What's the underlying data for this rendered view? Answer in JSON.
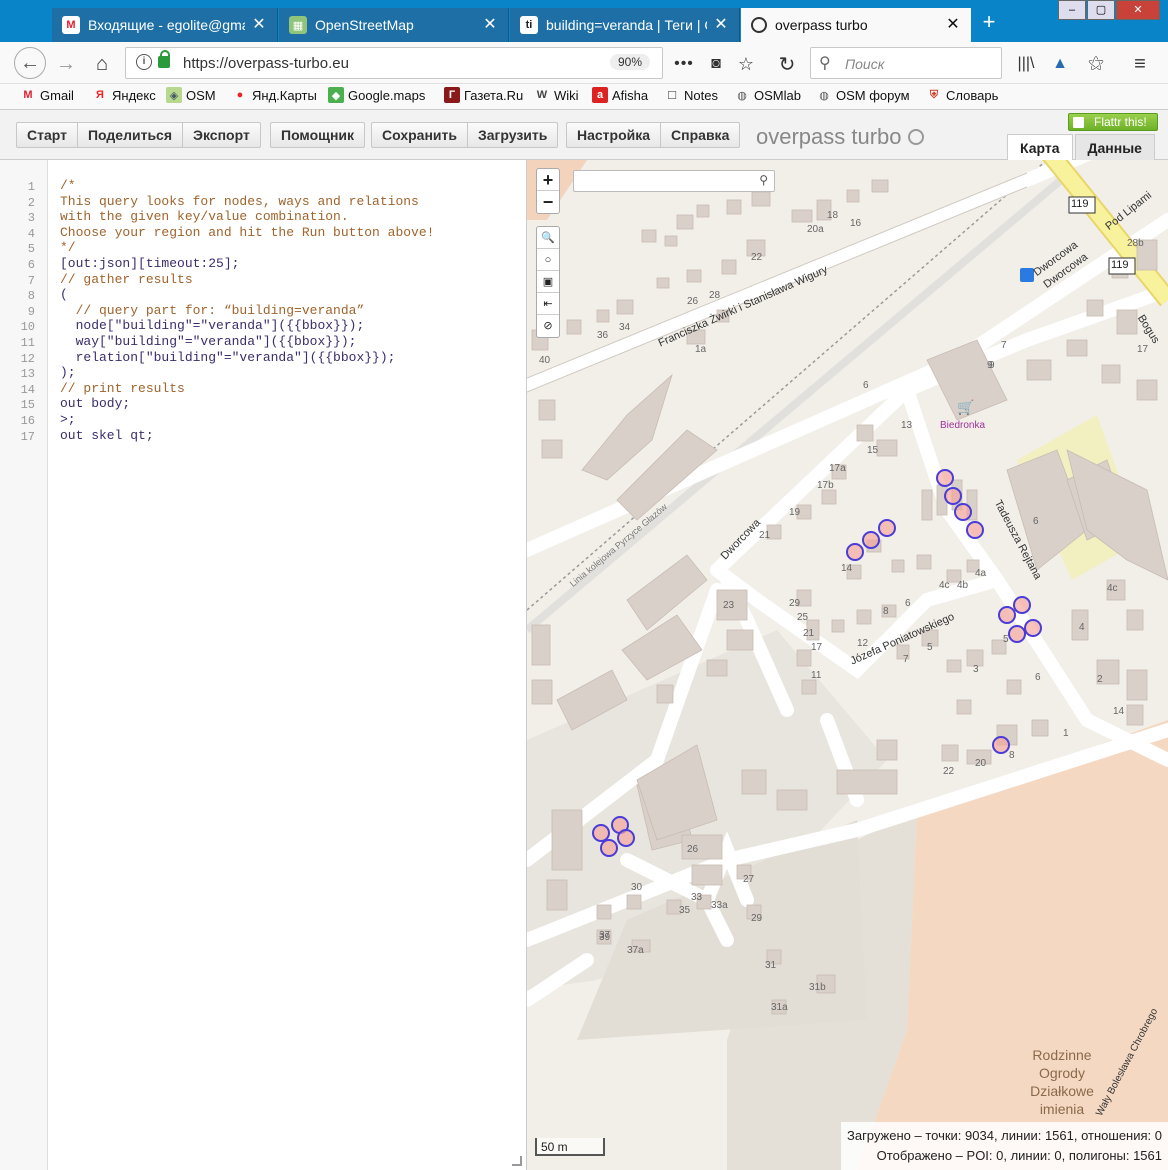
{
  "browser": {
    "tabs": [
      {
        "title": "Входящие - egolite@gmail.c",
        "icon": "gmail-icon",
        "active": false
      },
      {
        "title": "OpenStreetMap",
        "icon": "map-icon",
        "active": false
      },
      {
        "title": "building=veranda | Теги | O",
        "icon": "taginfo-icon",
        "active": false
      },
      {
        "title": "overpass turbo",
        "icon": "overpass-icon",
        "active": true
      }
    ],
    "url": "https://overpass-turbo.eu",
    "zoom": "90%",
    "search_placeholder": "Поиск",
    "bookmarks": [
      "Gmail",
      "Яндекс",
      "OSM",
      "Янд.Карты",
      "Google.maps",
      "Газета.Ru",
      "Wiki",
      "Afisha",
      "Notes",
      "OSMlab",
      "OSM форум",
      "Словарь"
    ]
  },
  "app": {
    "toolbar_groups": [
      [
        "Старт",
        "Поделиться",
        "Экспорт"
      ],
      [
        "Помощник"
      ],
      [
        "Сохранить",
        "Загрузить"
      ],
      [
        "Настройка",
        "Справка"
      ]
    ],
    "title": "overpass turbo",
    "flattr": "Flattr this!",
    "view_tabs": [
      "Карта",
      "Данные"
    ]
  },
  "editor": {
    "lines": [
      "/*",
      "This query looks for nodes, ways and relations",
      "with the given key/value combination.",
      "Choose your region and hit the Run button above!",
      "*/",
      "[out:json][timeout:25];",
      "// gather results",
      "(",
      "  // query part for: “building=veranda”",
      "  node[\"building\"=\"veranda\"]({{bbox}});",
      "  way[\"building\"=\"veranda\"]({{bbox}});",
      "  relation[\"building\"=\"veranda\"]({{bbox}});",
      ");",
      "// print results",
      "out body;",
      ">;",
      "out skel qt;"
    ]
  },
  "map": {
    "zoom_in": "+",
    "zoom_out": "−",
    "scale": "50 m",
    "stats_loaded": "Загружено – точки: 9034, линии: 1561, отношения: 0",
    "stats_shown": "Отображено – POI: 0, линии: 0, полигоны: 1561",
    "streets": [
      "Franciszka Żwirki i Stanisława Wigury",
      "Dworcowa",
      "Dworcowa",
      "Dworcowa",
      "Józefa Poniatowskiego",
      "Tadeusza Rejtana",
      "Linia kolejowa Pyrzyce Głazów",
      "Pod Lipami",
      "Bogus",
      "Wały Bolesława Chrobrego"
    ],
    "poi": [
      "Biedronka"
    ],
    "area_label": [
      "Rodzinne",
      "Ogrody",
      "Działkowe",
      "imienia"
    ],
    "road_refs": [
      "119",
      "119"
    ],
    "house_numbers": [
      "20a",
      "18",
      "16",
      "22",
      "26",
      "28",
      "36",
      "34",
      "40",
      "1a",
      "6",
      "13",
      "15",
      "17a",
      "17b",
      "19",
      "21",
      "14",
      "23",
      "29",
      "25",
      "21",
      "17",
      "11",
      "12",
      "8",
      "6",
      "7",
      "5",
      "4c",
      "4b",
      "4a",
      "3",
      "5",
      "4c",
      "6",
      "4",
      "2",
      "14",
      "1",
      "22",
      "20",
      "8",
      "26",
      "30",
      "33",
      "35",
      "33a",
      "27",
      "29",
      "37",
      "37a",
      "39",
      "31",
      "31b",
      "31a",
      "7",
      "9",
      "17",
      "28b",
      "9",
      "6"
    ]
  }
}
